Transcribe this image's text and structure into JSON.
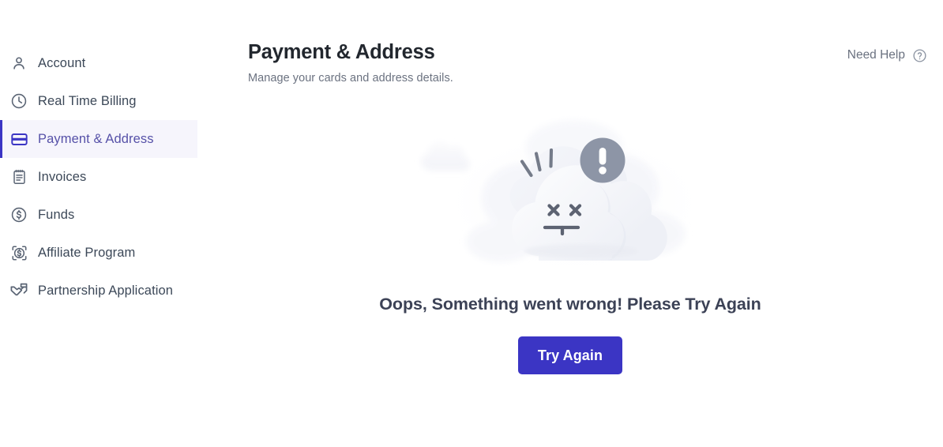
{
  "sidebar": {
    "items": [
      {
        "label": "Account",
        "icon": "user-icon",
        "active": false
      },
      {
        "label": "Real Time Billing",
        "icon": "clock-icon",
        "active": false
      },
      {
        "label": "Payment & Address",
        "icon": "credit-card-icon",
        "active": true
      },
      {
        "label": "Invoices",
        "icon": "document-icon",
        "active": false
      },
      {
        "label": "Funds",
        "icon": "dollar-circle-icon",
        "active": false
      },
      {
        "label": "Affiliate Program",
        "icon": "affiliate-icon",
        "active": false
      },
      {
        "label": "Partnership Application",
        "icon": "handshake-icon",
        "active": false
      }
    ]
  },
  "header": {
    "title": "Payment & Address",
    "subtitle": "Manage your cards and address details.",
    "help": {
      "label": "Need Help",
      "icon": "question-circle-icon"
    }
  },
  "error_state": {
    "illustration": "sad-cloud-error-illustration",
    "badge_icon": "exclamation-circle-icon",
    "message": "Oops, Something went wrong! Please Try Again",
    "button_label": "Try Again"
  },
  "colors": {
    "accent": "#3b35c4",
    "active_nav_bg": "#f6f5fc",
    "active_nav_text": "#5651a8",
    "nav_text": "#3c4858",
    "title": "#22272e",
    "subtitle": "#6b7280",
    "error_text": "#3c4256",
    "badge_gray": "#8d95a6"
  }
}
